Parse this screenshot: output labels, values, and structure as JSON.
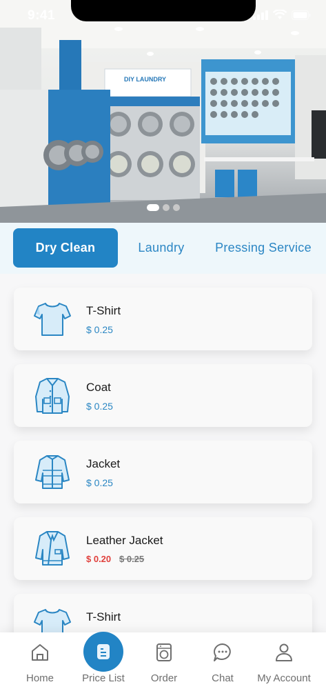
{
  "status_bar": {
    "time": "9:41"
  },
  "hero": {
    "slide_count": 3,
    "active_slide": 1,
    "sign_text": "DIY LAUNDRY"
  },
  "tabs": [
    {
      "label": "Dry Clean",
      "active": true
    },
    {
      "label": "Laundry",
      "active": false
    },
    {
      "label": "Pressing Service",
      "active": false
    }
  ],
  "items": [
    {
      "name": "T-Shirt",
      "price": "$ 0.25",
      "icon": "tshirt-icon"
    },
    {
      "name": "Coat",
      "price": "$ 0.25",
      "icon": "coat-icon"
    },
    {
      "name": "Jacket",
      "price": "$ 0.25",
      "icon": "jacket-icon"
    },
    {
      "name": "Leather Jacket",
      "sale_price": "$ 0.20",
      "old_price": "$ 0.25",
      "icon": "leather-jacket-icon"
    },
    {
      "name": "T-Shirt",
      "icon": "tshirt-icon"
    }
  ],
  "bottom_nav": [
    {
      "label": "Home",
      "icon": "home-icon"
    },
    {
      "label": "Price List",
      "icon": "price-list-icon",
      "active": true
    },
    {
      "label": "Order",
      "icon": "washing-machine-icon"
    },
    {
      "label": "Chat",
      "icon": "chat-icon"
    },
    {
      "label": "My Account",
      "icon": "user-icon"
    }
  ],
  "colors": {
    "accent": "#2284c5",
    "sale": "#e0403c",
    "tab_bg": "#eef7fb"
  }
}
